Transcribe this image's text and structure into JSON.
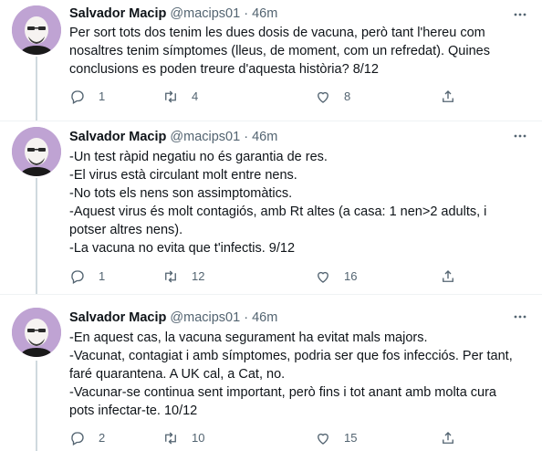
{
  "tweets": [
    {
      "author": "Salvador Macip",
      "handle": "@macips01",
      "dot": "·",
      "time": "46m",
      "lines": [
        "Per sort tots dos tenim les dues dosis de vacuna, però tant l'hereu com",
        "nosaltres tenim símptomes (lleus, de moment, com un refredat). Quines",
        "conclusions es poden treure d'aquesta història? 8/12"
      ],
      "replies": "1",
      "retweets": "4",
      "likes": "8"
    },
    {
      "author": "Salvador Macip",
      "handle": "@macips01",
      "dot": "·",
      "time": "46m",
      "lines": [
        "-Un test ràpid negatiu no és garantia de res.",
        "-El virus està circulant molt entre nens.",
        "-No tots els nens son assimptomàtics.",
        "-Aquest virus és molt contagiós, amb Rt altes (a casa: 1 nen>2 adults, i",
        "potser altres nens).",
        "-La vacuna no evita que t'infectis. 9/12"
      ],
      "replies": "1",
      "retweets": "12",
      "likes": "16"
    },
    {
      "author": "Salvador Macip",
      "handle": "@macips01",
      "dot": "·",
      "time": "46m",
      "lines": [
        "-En aquest cas, la vacuna segurament ha evitat mals majors.",
        "-Vacunat, contagiat i amb símptomes, podria ser que fos infecciós. Per tant,",
        "faré quarantena. A UK cal, a Cat, no.",
        "-Vacunar-se continua sent important, però fins i tot anant amb molta cura",
        "pots infectar-te. 10/12"
      ],
      "replies": "2",
      "retweets": "10",
      "likes": "15"
    }
  ],
  "colors": {
    "text_primary": "#0f1419",
    "text_secondary": "#536471",
    "divider": "#eff3f4",
    "thread_line": "#cfd9de",
    "avatar_bg": "#bfa3d3"
  },
  "icons": [
    "avatar",
    "more-icon",
    "reply-icon",
    "retweet-icon",
    "like-icon",
    "share-icon"
  ]
}
